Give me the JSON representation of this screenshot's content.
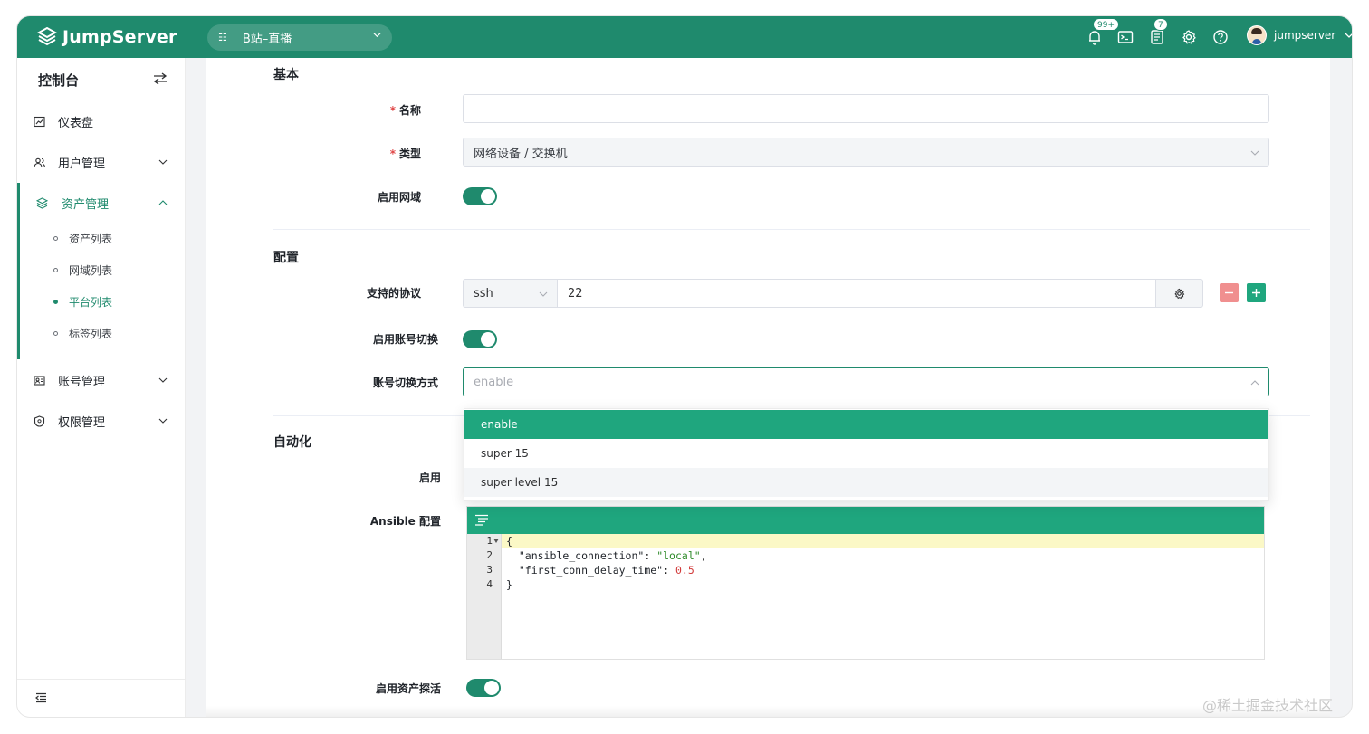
{
  "app": {
    "logo_text": "JumpServer"
  },
  "header": {
    "org_label": "B站–直播",
    "notifications_badge": "99+",
    "tickets_badge": "7",
    "username": "jumpserver",
    "accent_color": "#1f8a6d"
  },
  "sidebar": {
    "title": "控制台",
    "items": [
      {
        "label": "仪表盘",
        "icon": "dashboard-icon"
      },
      {
        "label": "用户管理",
        "icon": "users-icon"
      },
      {
        "label": "资产管理",
        "icon": "layers-icon",
        "active": true
      },
      {
        "label": "账号管理",
        "icon": "account-icon"
      },
      {
        "label": "权限管理",
        "icon": "shield-icon"
      }
    ],
    "sub_items": [
      {
        "label": "资产列表"
      },
      {
        "label": "网域列表"
      },
      {
        "label": "平台列表",
        "active": true
      },
      {
        "label": "标签列表"
      }
    ]
  },
  "form": {
    "section_basic": "基本",
    "name_label": "名称",
    "name_value": "",
    "type_label": "类型",
    "type_value": "网络设备 / 交换机",
    "domain_label": "启用网域",
    "domain_enabled": true,
    "section_config": "配置",
    "protocol_label": "支持的协议",
    "protocol_value": "ssh",
    "port_value": "22",
    "su_label": "启用账号切换",
    "su_enabled": true,
    "su_method_label": "账号切换方式",
    "su_method_placeholder": "enable",
    "su_method_options": [
      "enable",
      "super 15",
      "super level 15"
    ],
    "su_method_selected": "enable",
    "section_automation": "自动化",
    "auto_enable_label": "启用",
    "ansible_label": "Ansible 配置",
    "ansible_lines": [
      "1",
      "2",
      "3",
      "4"
    ],
    "ansible_code": {
      "open": "{",
      "key1": "\"ansible_connection\"",
      "val1": "\"local\"",
      "key2": "\"first_conn_delay_time\"",
      "val2": "0.5",
      "close": "}"
    },
    "ping_label": "启用资产探活",
    "ping_enabled": true
  },
  "watermark": "@稀土掘金技术社区"
}
